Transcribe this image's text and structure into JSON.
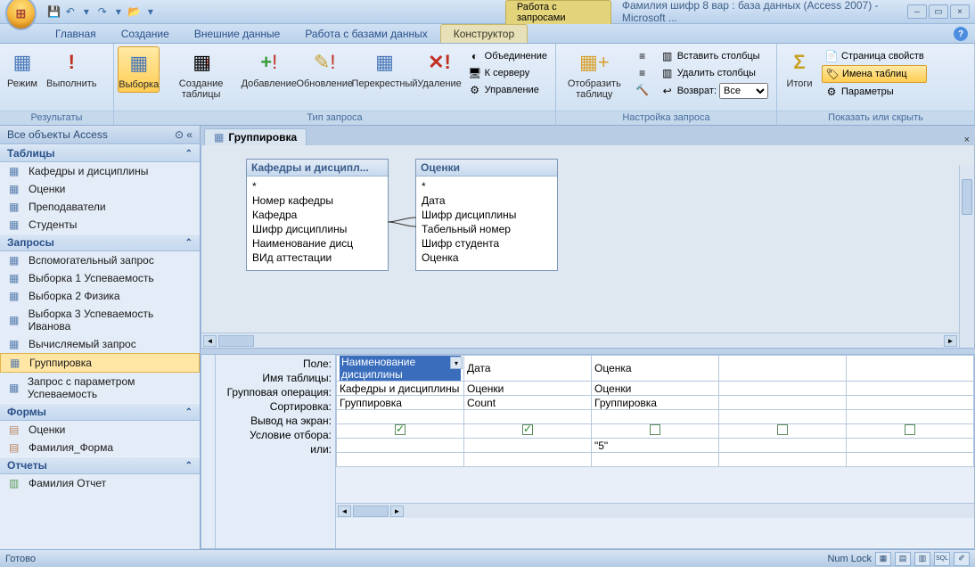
{
  "title": "Фамилия шифр 8 вар : база данных (Access 2007) - Microsoft ...",
  "context_tab": "Работа с запросами",
  "tabs": [
    "Главная",
    "Создание",
    "Внешние данные",
    "Работа с базами данных",
    "Конструктор"
  ],
  "ribbon": {
    "groups": {
      "results": {
        "label": "Результаты",
        "mode": "Режим",
        "run": "Выполнить"
      },
      "qtype": {
        "label": "Тип запроса",
        "select": "Выборка",
        "maketable": "Создание таблицы",
        "append": "Добавление",
        "update": "Обновление",
        "crosstab": "Перекрестный",
        "delete": "Удаление",
        "union": "Объединение",
        "server": "К серверу",
        "managed": "Управление"
      },
      "setup": {
        "label": "Настройка запроса",
        "showtable": "Отобразить таблицу",
        "insertcols": "Вставить столбцы",
        "deletecols": "Удалить столбцы",
        "return": "Возврат:",
        "return_val": "Все"
      },
      "totals_group": {
        "label": "Показать или скрыть",
        "totals": "Итоги",
        "propsheet": "Страница свойств",
        "tablenames": "Имена таблиц",
        "params": "Параметры"
      }
    }
  },
  "nav": {
    "header": "Все объекты Access",
    "sections": {
      "tables": {
        "label": "Таблицы",
        "items": [
          "Кафедры и дисциплины",
          "Оценки",
          "Преподаватели",
          "Студенты"
        ]
      },
      "queries": {
        "label": "Запросы",
        "items": [
          "Вспомогательный запрос",
          "Выборка 1 Успеваемость",
          "Выборка 2 Физика",
          "Выборка 3 Успеваемость Иванова",
          "Вычисляемый запрос",
          "Группировка",
          "Запрос с параметром Успеваемость"
        ]
      },
      "forms": {
        "label": "Формы",
        "items": [
          "Оценки",
          "Фамилия_Форма"
        ]
      },
      "reports": {
        "label": "Отчеты",
        "items": [
          "Фамилия Отчет"
        ]
      }
    },
    "selected": "Группировка"
  },
  "doc_tab": "Группировка",
  "design_tables": {
    "t1": {
      "title": "Кафедры и дисципл...",
      "fields": [
        "*",
        "Номер кафедры",
        "Кафедра",
        "Шифр дисциплины",
        "Наименование дисц",
        "ВИд аттестации"
      ]
    },
    "t2": {
      "title": "Оценки",
      "fields": [
        "*",
        "Дата",
        "Шифр дисциплины",
        "Табельный номер",
        "Шифр студента",
        "Оценка"
      ]
    }
  },
  "grid": {
    "row_labels": [
      "Поле:",
      "Имя таблицы:",
      "Групповая операция:",
      "Сортировка:",
      "Вывод на экран:",
      "Условие отбора:",
      "или:"
    ],
    "cols": [
      {
        "field": "Наименование дисциплины",
        "table": "Кафедры и дисциплины",
        "op": "Группировка",
        "sort": "",
        "show": true,
        "crit": "",
        "or": ""
      },
      {
        "field": "Дата",
        "table": "Оценки",
        "op": "Count",
        "sort": "",
        "show": true,
        "crit": "",
        "or": ""
      },
      {
        "field": "Оценка",
        "table": "Оценки",
        "op": "Группировка",
        "sort": "",
        "show": false,
        "crit": "\"5\"",
        "or": ""
      },
      {
        "field": "",
        "table": "",
        "op": "",
        "sort": "",
        "show": false,
        "crit": "",
        "or": ""
      },
      {
        "field": "",
        "table": "",
        "op": "",
        "sort": "",
        "show": false,
        "crit": "",
        "or": ""
      }
    ]
  },
  "status": {
    "ready": "Готово",
    "numlock": "Num Lock"
  }
}
